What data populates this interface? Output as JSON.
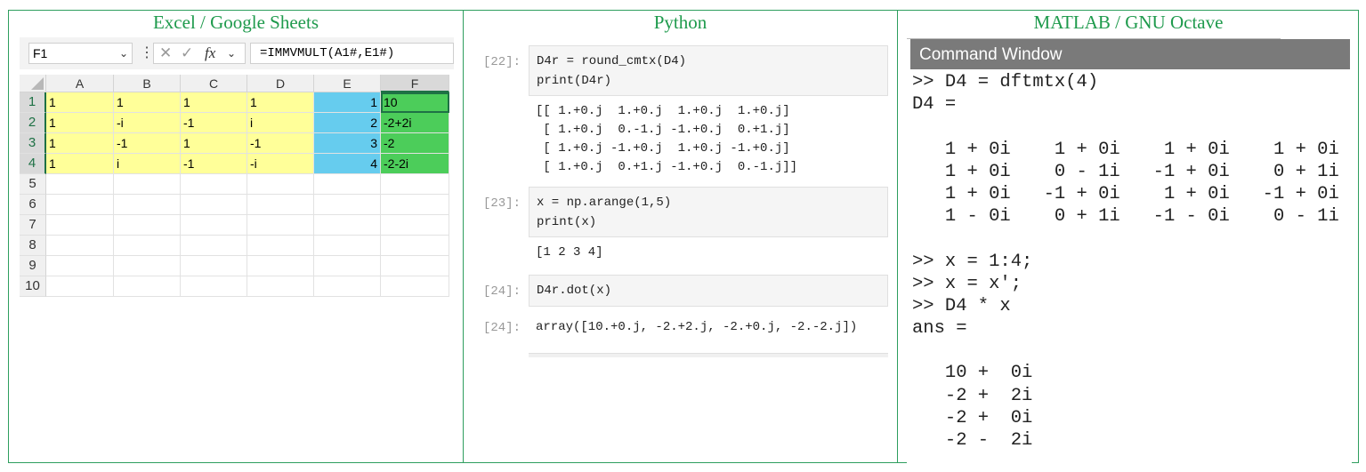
{
  "titles": {
    "excel": "Excel / Google Sheets",
    "python": "Python",
    "matlab": "MATLAB / GNU Octave"
  },
  "excel": {
    "name_box": "F1",
    "fx_label": "fx",
    "formula": "=IMMVMULT(A1#,E1#)",
    "columns": [
      "A",
      "B",
      "C",
      "D",
      "E",
      "F"
    ],
    "rows": [
      "1",
      "2",
      "3",
      "4",
      "5",
      "6",
      "7",
      "8",
      "9",
      "10"
    ],
    "cells": [
      [
        "1",
        "1",
        "1",
        "1",
        "1",
        "10"
      ],
      [
        "1",
        "-i",
        "-1",
        "i",
        "2",
        "-2+2i"
      ],
      [
        "1",
        "-1",
        "1",
        "-1",
        "3",
        "-2"
      ],
      [
        "1",
        "i",
        "-1",
        "-i",
        "4",
        "-2-2i"
      ]
    ],
    "colors": {
      "matrix": "#ffff99",
      "vector": "#66ccee",
      "result": "#4ccd5a"
    }
  },
  "python": {
    "cells": [
      {
        "in_prompt": "[22]:",
        "input": [
          "D4r = round_cmtx(D4)",
          "print(D4r)"
        ],
        "output": [
          "[[ 1.+0.j  1.+0.j  1.+0.j  1.+0.j]",
          " [ 1.+0.j  0.-1.j -1.+0.j  0.+1.j]",
          " [ 1.+0.j -1.+0.j  1.+0.j -1.+0.j]",
          " [ 1.+0.j  0.+1.j -1.+0.j  0.-1.j]]"
        ]
      },
      {
        "in_prompt": "[23]:",
        "input": [
          "x = np.arange(1,5)",
          "print(x)"
        ],
        "output": [
          "[1 2 3 4]"
        ]
      },
      {
        "in_prompt": "[24]:",
        "input": [
          "D4r.dot(x)"
        ],
        "out_prompt": "[24]:",
        "output": [
          "array([10.+0.j, -2.+2.j, -2.+0.j, -2.-2.j])"
        ]
      }
    ]
  },
  "matlab": {
    "window_title": "Command Window",
    "lines": [
      ">> D4 = dftmtx(4)",
      "D4 =",
      "",
      "   1 + 0i    1 + 0i    1 + 0i    1 + 0i",
      "   1 + 0i    0 - 1i   -1 + 0i    0 + 1i",
      "   1 + 0i   -1 + 0i    1 + 0i   -1 + 0i",
      "   1 - 0i    0 + 1i   -1 - 0i    0 - 1i",
      "",
      ">> x = 1:4;",
      ">> x = x';",
      ">> D4 * x",
      "ans =",
      "",
      "   10 +  0i",
      "   -2 +  2i",
      "   -2 +  0i",
      "   -2 -  2i"
    ]
  }
}
